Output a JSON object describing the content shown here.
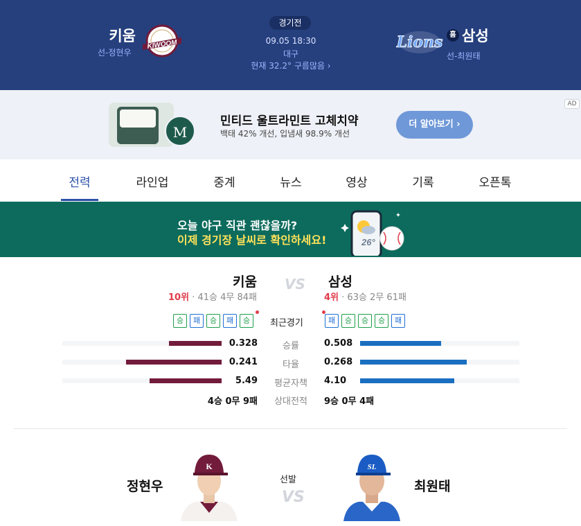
{
  "header": {
    "status": "경기전",
    "datetime": "09.05 18:30",
    "stadium": "대구",
    "weather": "현재 32.2° 구름많음 ›",
    "away": {
      "name": "키움",
      "starter": "선-정현우",
      "logo_text": "KIWOOM"
    },
    "home": {
      "name": "삼성",
      "starter": "선-최원태",
      "home_badge": "홈",
      "logo_text": "Lions"
    }
  },
  "ad": {
    "title": "민티드 울트라민트 고체치약",
    "desc": "백태 42% 개선, 입냄새 98.9% 개선",
    "button": "더 알아보기 ›",
    "badge": "AD",
    "brand_letter": "M"
  },
  "tabs": [
    {
      "label": "전력",
      "active": true
    },
    {
      "label": "라인업"
    },
    {
      "label": "중계"
    },
    {
      "label": "뉴스"
    },
    {
      "label": "영상"
    },
    {
      "label": "기록"
    },
    {
      "label": "오픈톡"
    }
  ],
  "banner": {
    "line1": "오늘 야구 직관 괜찮을까?",
    "line2": "이제 경기장 날씨로 확인하세요!",
    "temp": "26°"
  },
  "comparison": {
    "vs": "VS",
    "away": {
      "name": "키움",
      "rank": "10위",
      "record": "· 41승 4무 84패"
    },
    "home": {
      "name": "삼성",
      "rank": "4위",
      "record": "· 63승 2무 61패"
    },
    "recent_label": "최근경기",
    "away_recent": [
      "승",
      "패",
      "승",
      "패",
      "승"
    ],
    "home_recent": [
      "패",
      "승",
      "승",
      "승",
      "패"
    ],
    "stats": [
      {
        "label": "승률",
        "away": "0.328",
        "home": "0.508",
        "away_ratio": 0.33,
        "home_ratio": 0.51
      },
      {
        "label": "타율",
        "away": "0.241",
        "home": "0.268",
        "away_ratio": 0.6,
        "home_ratio": 0.67
      },
      {
        "label": "평균자책",
        "away": "5.49",
        "home": "4.10",
        "away_ratio": 0.45,
        "home_ratio": 0.59
      },
      {
        "label": "상대전적",
        "away": "4승 0무 9패",
        "home": "9승 0무 4패"
      }
    ]
  },
  "starters": {
    "label": "선발",
    "vs": "VS",
    "away": "정현우",
    "home": "최원태"
  },
  "colors": {
    "header_bg": "#26407e",
    "kiwoom": "#721b3a",
    "samsung": "#1a6fc0",
    "win": "#1c9e49",
    "loss": "#1f6ed4",
    "rank": "#e03b4a"
  }
}
